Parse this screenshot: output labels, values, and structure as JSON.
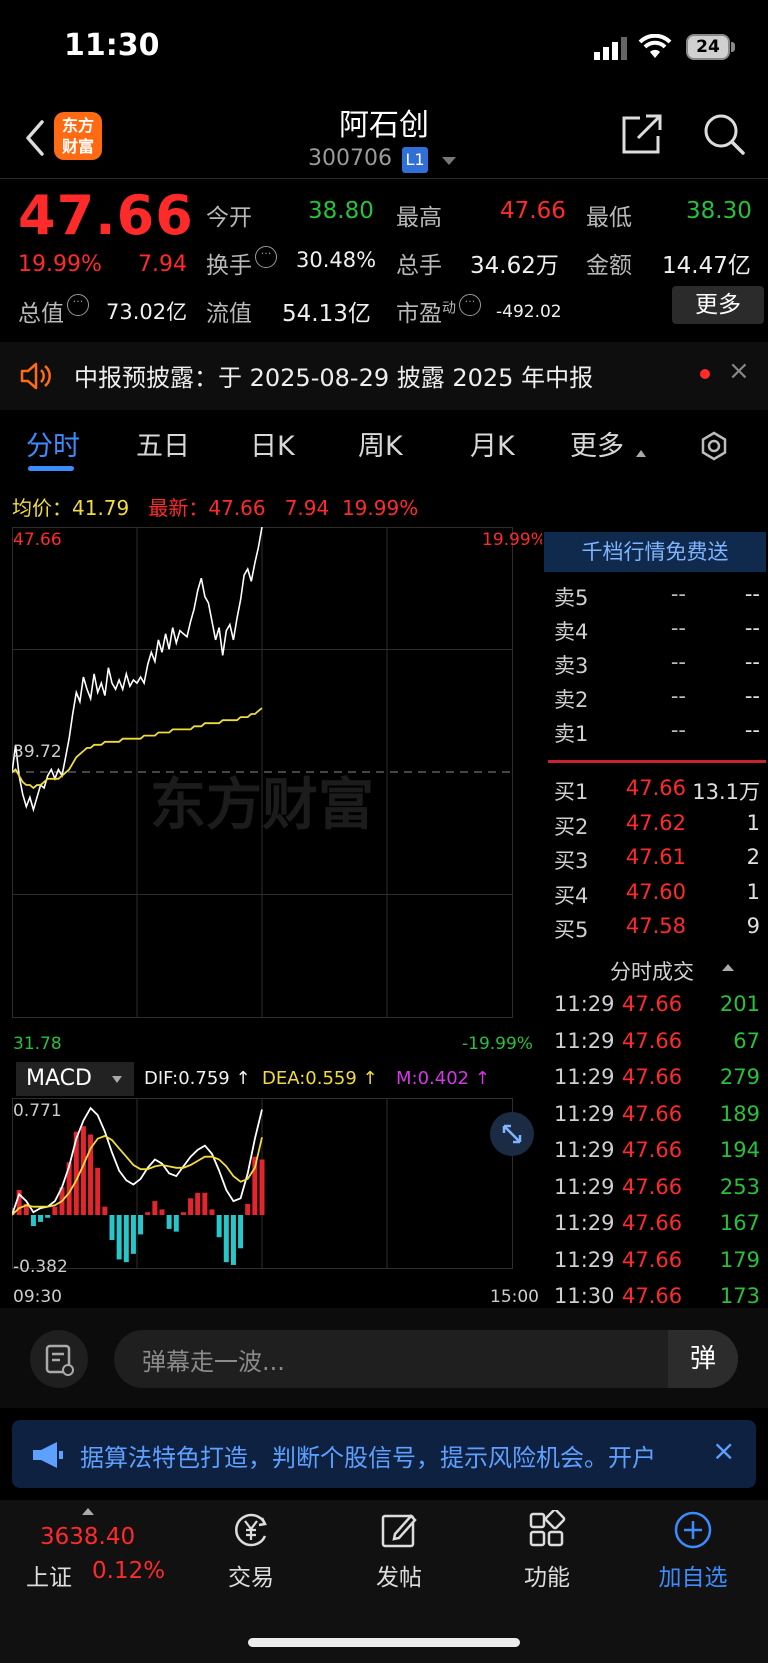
{
  "status": {
    "time": "11:30",
    "battery": "24"
  },
  "header": {
    "name": "阿石创",
    "code": "300706",
    "level": "L1",
    "logo_line1": "东方",
    "logo_line2": "财富"
  },
  "quote": {
    "price": "47.66",
    "change_pct": "19.99%",
    "change_abs": "7.94",
    "open_label": "今开",
    "open": "38.80",
    "high_label": "最高",
    "high": "47.66",
    "low_label": "最低",
    "low": "38.30",
    "turnover_label": "换手",
    "turnover": "30.48%",
    "volume_label": "总手",
    "volume": "34.62万",
    "amount_label": "金额",
    "amount": "14.47亿",
    "mktcap_label": "总值",
    "mktcap": "73.02亿",
    "float_label": "流值",
    "float": "54.13亿",
    "pe_label": "市盈",
    "pe_sup": "动",
    "pe": "-492.02",
    "more": "更多"
  },
  "notice": {
    "text": "中报预披露：于 2025-08-29 披露 2025 年中报",
    "close": "×"
  },
  "tabs": [
    "分时",
    "五日",
    "日K",
    "周K",
    "月K",
    "更多"
  ],
  "avg": {
    "avg_label": "均价：",
    "avg": "41.79",
    "latest_label": "最新：",
    "latest": "47.66",
    "chg": "7.94",
    "pct": "19.99%"
  },
  "chart_data": {
    "type": "line",
    "title": "",
    "x_start": "09:30",
    "x_end": "15:00",
    "y_top": "47.66",
    "y_mid": "39.72",
    "y_bottom": "31.78",
    "pct_top": "19.99%",
    "pct_bottom": "-19.99%",
    "ylim": [
      31.78,
      47.66
    ],
    "series": [
      {
        "name": "",
        "color": "#ffffff",
        "values": [
          39.7,
          40.6,
          39.6,
          39.0,
          38.6,
          38.9,
          38.5,
          38.9,
          39.3,
          39.2,
          39.6,
          39.8,
          39.5,
          39.8,
          39.6,
          40.2,
          40.8,
          41.6,
          42.3,
          42.0,
          42.8,
          42.4,
          42.1,
          42.9,
          42.3,
          42.6,
          42.2,
          43.1,
          42.6,
          42.4,
          42.7,
          42.4,
          42.9,
          42.5,
          42.7,
          42.6,
          42.8,
          42.6,
          43.2,
          43.6,
          43.3,
          44.0,
          43.6,
          44.2,
          43.7,
          44.4,
          43.9,
          44.3,
          44.2,
          44.1,
          44.6,
          45.0,
          45.6,
          46.0,
          45.4,
          45.2,
          44.6,
          44.0,
          44.4,
          43.5,
          44.3,
          44.5,
          44.0,
          44.7,
          45.3,
          46.1,
          46.3,
          45.9,
          46.5,
          47.0,
          47.66
        ]
      },
      {
        "name": "均价",
        "color": "#f2dc3c",
        "values": [
          39.7,
          39.8,
          39.6,
          39.4,
          39.3,
          39.3,
          39.2,
          39.3,
          39.3,
          39.4,
          39.5,
          39.5,
          39.5,
          39.5,
          39.6,
          39.7,
          39.8,
          40.0,
          40.2,
          40.3,
          40.4,
          40.5,
          40.5,
          40.6,
          40.6,
          40.6,
          40.7,
          40.7,
          40.7,
          40.7,
          40.7,
          40.8,
          40.8,
          40.8,
          40.8,
          40.8,
          40.8,
          40.9,
          40.9,
          40.9,
          40.9,
          41.0,
          41.0,
          41.0,
          41.0,
          41.1,
          41.1,
          41.1,
          41.1,
          41.1,
          41.1,
          41.2,
          41.2,
          41.2,
          41.3,
          41.3,
          41.3,
          41.3,
          41.3,
          41.4,
          41.4,
          41.4,
          41.4,
          41.4,
          41.5,
          41.5,
          41.5,
          41.6,
          41.6,
          41.7,
          41.79
        ]
      }
    ]
  },
  "macd": {
    "label": "MACD",
    "dif": "DIF:0.759 ↑",
    "dea": "DEA:0.559 ↑",
    "m": "M:0.402 ↑",
    "top": "0.771",
    "bottom": "-0.382",
    "ylim": [
      -0.382,
      0.771
    ],
    "dif_values": [
      0.0,
      0.15,
      0.1,
      0.02,
      0.05,
      0.06,
      0.1,
      0.2,
      0.35,
      0.55,
      0.68,
      0.77,
      0.72,
      0.6,
      0.45,
      0.32,
      0.25,
      0.22,
      0.26,
      0.34,
      0.4,
      0.37,
      0.3,
      0.28,
      0.35,
      0.42,
      0.47,
      0.5,
      0.44,
      0.32,
      0.18,
      0.1,
      0.12,
      0.3,
      0.55,
      0.76
    ],
    "dea_values": [
      0.0,
      0.05,
      0.07,
      0.06,
      0.06,
      0.06,
      0.07,
      0.1,
      0.16,
      0.25,
      0.36,
      0.48,
      0.55,
      0.57,
      0.54,
      0.48,
      0.42,
      0.36,
      0.33,
      0.33,
      0.35,
      0.36,
      0.35,
      0.34,
      0.34,
      0.36,
      0.39,
      0.42,
      0.42,
      0.4,
      0.35,
      0.28,
      0.24,
      0.26,
      0.34,
      0.56
    ],
    "hist_values": [
      0.05,
      0.18,
      0.08,
      -0.08,
      -0.05,
      -0.02,
      0.06,
      0.2,
      0.38,
      0.6,
      0.64,
      0.58,
      0.34,
      0.06,
      -0.18,
      -0.32,
      -0.34,
      -0.28,
      -0.14,
      0.02,
      0.1,
      0.04,
      -0.1,
      -0.12,
      0.02,
      0.12,
      0.16,
      0.16,
      0.04,
      -0.16,
      -0.34,
      -0.36,
      -0.24,
      0.08,
      0.42,
      0.4
    ]
  },
  "orderbook": {
    "banner": "千档行情免费送",
    "asks": [
      {
        "label": "卖5",
        "price": "--",
        "vol": "--"
      },
      {
        "label": "卖4",
        "price": "--",
        "vol": "--"
      },
      {
        "label": "卖3",
        "price": "--",
        "vol": "--"
      },
      {
        "label": "卖2",
        "price": "--",
        "vol": "--"
      },
      {
        "label": "卖1",
        "price": "--",
        "vol": "--"
      }
    ],
    "bids": [
      {
        "label": "买1",
        "price": "47.66",
        "vol": "13.1万"
      },
      {
        "label": "买2",
        "price": "47.62",
        "vol": "1"
      },
      {
        "label": "买3",
        "price": "47.61",
        "vol": "2"
      },
      {
        "label": "买4",
        "price": "47.60",
        "vol": "1"
      },
      {
        "label": "买5",
        "price": "47.58",
        "vol": "9"
      }
    ],
    "trades_title": "分时成交",
    "trades": [
      {
        "time": "11:29",
        "price": "47.66",
        "vol": "201",
        "color": "#27c13a"
      },
      {
        "time": "11:29",
        "price": "47.66",
        "vol": "67",
        "color": "#27c13a"
      },
      {
        "time": "11:29",
        "price": "47.66",
        "vol": "279",
        "color": "#27c13a"
      },
      {
        "time": "11:29",
        "price": "47.66",
        "vol": "189",
        "color": "#27c13a"
      },
      {
        "time": "11:29",
        "price": "47.66",
        "vol": "194",
        "color": "#27c13a"
      },
      {
        "time": "11:29",
        "price": "47.66",
        "vol": "253",
        "color": "#27c13a"
      },
      {
        "time": "11:29",
        "price": "47.66",
        "vol": "167",
        "color": "#27c13a"
      },
      {
        "time": "11:29",
        "price": "47.66",
        "vol": "179",
        "color": "#27c13a"
      },
      {
        "time": "11:30",
        "price": "47.66",
        "vol": "173",
        "color": "#27c13a"
      }
    ]
  },
  "danmaku": {
    "placeholder": "弹幕走一波...",
    "send": "弹"
  },
  "ad": {
    "text": "据算法特色打造，判断个股信号，提示风险机会。开户",
    "close": "×"
  },
  "bottom": {
    "index_value": "3638.40",
    "index_name": "上证",
    "index_pct": "0.12%",
    "trade": "交易",
    "post": "发帖",
    "func": "功能",
    "watch": "加自选"
  },
  "watermark": "东方财富"
}
